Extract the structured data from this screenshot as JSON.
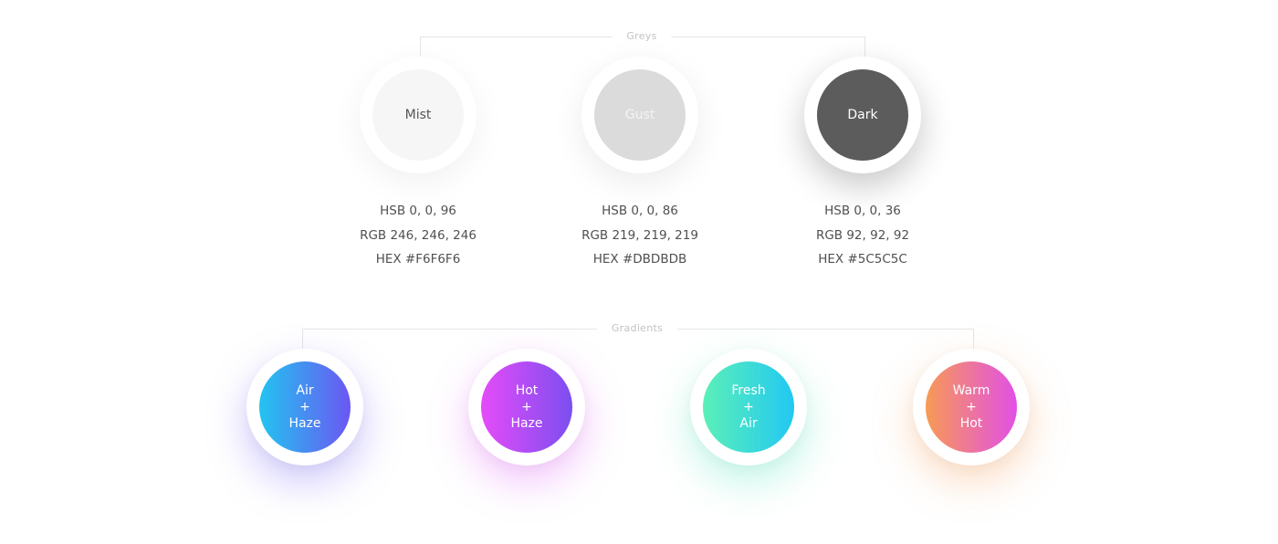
{
  "greys": {
    "section_label": "Greys",
    "items": [
      {
        "name": "Mist",
        "color": "#F6F6F6",
        "text_color": "#555555",
        "hsb": "HSB 0, 0, 96",
        "rgb": "RGB 246, 246, 246",
        "hex": "HEX #F6F6F6"
      },
      {
        "name": "Gust",
        "color": "#DBDBDB",
        "text_color": "#f4f4f4",
        "hsb": "HSB 0, 0, 86",
        "rgb": "RGB 219, 219, 219",
        "hex": "HEX #DBDBDB"
      },
      {
        "name": "Dark",
        "color": "#5C5C5C",
        "text_color": "#ffffff",
        "hsb": "HSB 0, 0, 36",
        "rgb": "RGB 92, 92, 92",
        "hex": "HEX #5C5C5C"
      }
    ]
  },
  "gradients": {
    "section_label": "Gradients",
    "items": [
      {
        "line1": "Air",
        "plus": "+",
        "line2": "Haze",
        "color_start": "#22C4F0",
        "color_end": "#6B57F2",
        "glow": "#7b6cf5"
      },
      {
        "line1": "Hot",
        "plus": "+",
        "line2": "Haze",
        "color_start": "#E54CF8",
        "color_end": "#7B4EF0",
        "glow": "#e067f7"
      },
      {
        "line1": "Fresh",
        "plus": "+",
        "line2": "Air",
        "color_start": "#5BF0B8",
        "color_end": "#22C8F2",
        "glow": "#5be8c2"
      },
      {
        "line1": "Warm",
        "plus": "+",
        "line2": "Hot",
        "color_start": "#F79A55",
        "color_end": "#E250E6",
        "glow": "#f7a460"
      }
    ]
  }
}
